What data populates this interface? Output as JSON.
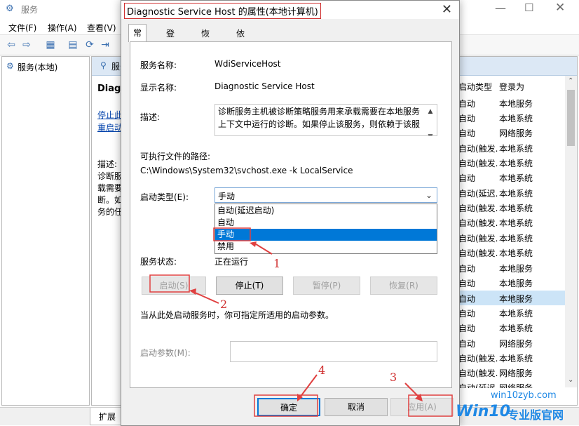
{
  "window": {
    "title": "服务",
    "menu": [
      "文件(F)",
      "操作(A)",
      "查看(V)"
    ],
    "tree_root": "服务(本地)",
    "panel_header": "服务(本地)",
    "detail_title": "Diagn",
    "detail_links": [
      "停止此",
      "重启动"
    ],
    "detail_desc": [
      "描述:",
      "诊断服",
      "载需要",
      "断。如",
      "务的任"
    ],
    "status_tab": "扩展"
  },
  "services_table": {
    "headers": [
      "启动类型",
      "登录为"
    ],
    "rows": [
      [
        "自动",
        "本地服务"
      ],
      [
        "自动",
        "本地系统"
      ],
      [
        "自动",
        "网络服务"
      ],
      [
        "自动(触发...",
        "本地系统"
      ],
      [
        "自动(触发...",
        "本地系统"
      ],
      [
        "自动",
        "本地系统"
      ],
      [
        "自动(延迟...",
        "本地系统"
      ],
      [
        "自动(触发...",
        "本地系统"
      ],
      [
        "自动(触发...",
        "本地系统"
      ],
      [
        "自动(触发...",
        "本地系统"
      ],
      [
        "自动(触发...",
        "本地系统"
      ],
      [
        "自动",
        "本地服务"
      ],
      [
        "自动",
        "本地服务"
      ],
      [
        "自动",
        "本地服务"
      ],
      [
        "自动",
        "本地系统"
      ],
      [
        "自动",
        "本地系统"
      ],
      [
        "自动",
        "网络服务"
      ],
      [
        "自动(触发...",
        "本地系统"
      ],
      [
        "自动(触发...",
        "网络服务"
      ],
      [
        "自动(延迟...",
        "网络服务"
      ]
    ]
  },
  "dialog": {
    "title": "Diagnostic Service Host 的属性(本地计算机)",
    "tabs": [
      "常规",
      "登录",
      "恢复",
      "依存关系"
    ],
    "service_name_label": "服务名称:",
    "service_name": "WdiServiceHost",
    "display_name_label": "显示名称:",
    "display_name": "Diagnostic Service Host",
    "description_label": "描述:",
    "description": "诊断服务主机被诊断策略服务用来承载需要在本地服务上下文中运行的诊断。如果停止该服务，则依赖于该服",
    "path_label": "可执行文件的路径:",
    "path": "C:\\Windows\\System32\\svchost.exe -k LocalService",
    "startup_type_label": "启动类型(E):",
    "startup_type_value": "手动",
    "startup_options": [
      "自动(延迟启动)",
      "自动",
      "手动",
      "禁用"
    ],
    "status_label": "服务状态:",
    "status_value": "正在运行",
    "buttons": {
      "start": "启动(S)",
      "stop": "停止(T)",
      "pause": "暂停(P)",
      "resume": "恢复(R)"
    },
    "hint": "当从此处启动服务时，你可指定所适用的启动参数。",
    "param_label": "启动参数(M):",
    "param_value": "",
    "footer": {
      "ok": "确定",
      "cancel": "取消",
      "apply": "应用(A)"
    }
  },
  "annotations": {
    "n1": "1",
    "n2": "2",
    "n3": "3",
    "n4": "4"
  },
  "watermark": {
    "brand": "Win10",
    "suffix": "专业版官网",
    "url": "win10zyb.com"
  },
  "colors": {
    "accent": "#0078d7",
    "annotation": "#d03030"
  }
}
